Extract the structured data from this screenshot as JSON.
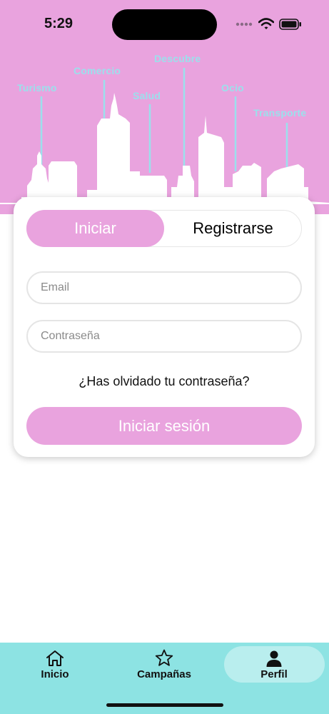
{
  "status_bar": {
    "time": "5:29",
    "signal_icon": "signal-dots-icon",
    "wifi_icon": "wifi-icon",
    "battery_icon": "battery-icon"
  },
  "hero": {
    "background_color": "#e9a3de",
    "label_color": "#9be0ec",
    "labels": {
      "turismo": "Turismo",
      "comercio": "Comercio",
      "salud": "Salud",
      "descubre": "Descubre",
      "ocio": "Ocio",
      "transporte": "Transporte"
    }
  },
  "auth": {
    "tabs": {
      "login": "Iniciar",
      "register": "Registrarse",
      "selected": "Iniciar"
    },
    "email_placeholder": "Email",
    "password_placeholder": "Contraseña",
    "forgot_password": "¿Has olvidado tu contraseña?",
    "submit_label": "Iniciar sesión",
    "accent_color": "#e9a3de"
  },
  "tabbar": {
    "background_color": "#8de3e3",
    "items": [
      {
        "label": "Inicio",
        "icon": "home-icon"
      },
      {
        "label": "Campañas",
        "icon": "star-icon"
      },
      {
        "label": "Perfil",
        "icon": "person-icon",
        "selected": true
      }
    ]
  }
}
